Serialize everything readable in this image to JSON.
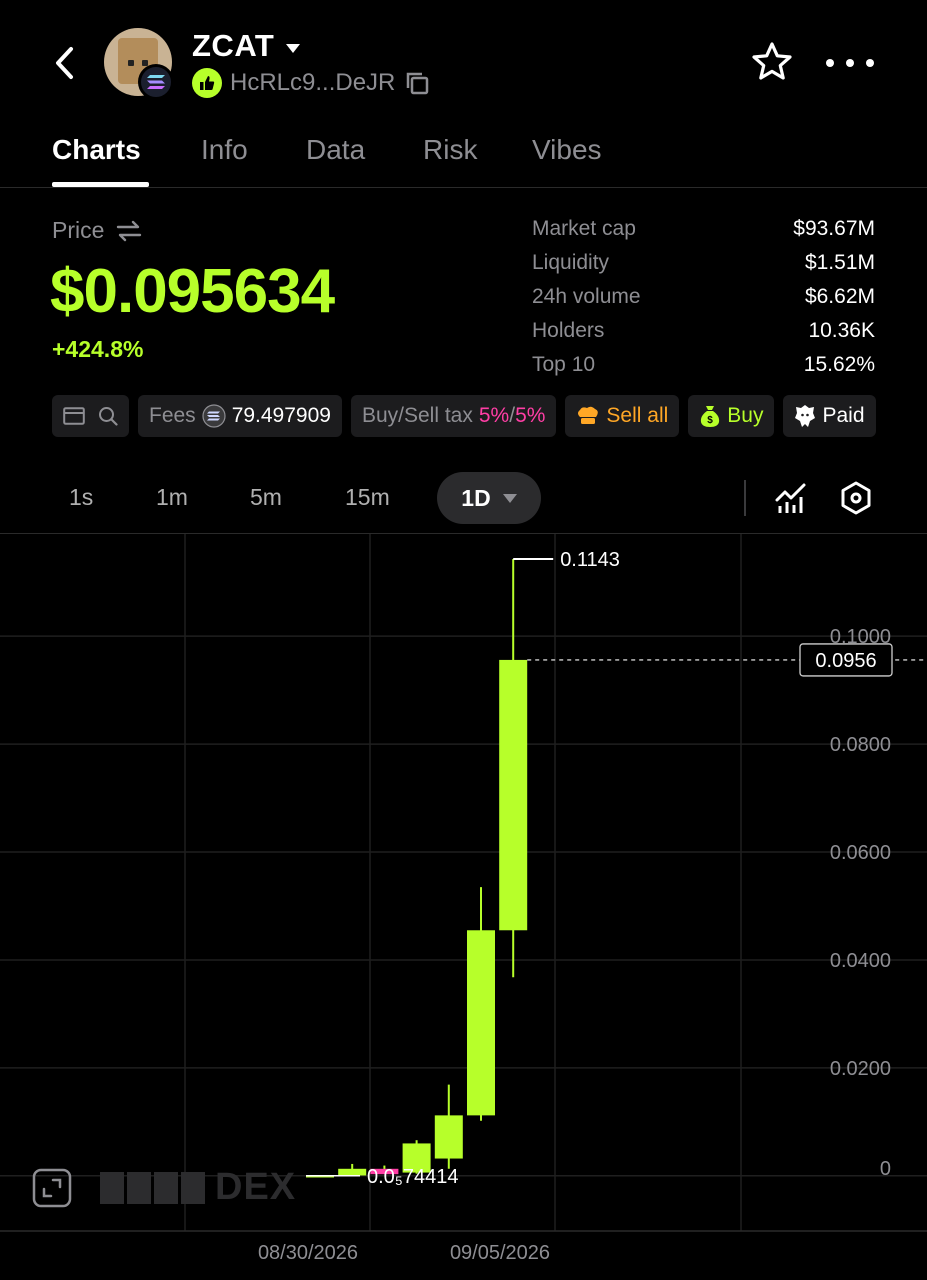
{
  "header": {
    "token_name": "ZCAT",
    "address": "HcRLc9...DeJR"
  },
  "tabs": [
    {
      "label": "Charts",
      "active": true
    },
    {
      "label": "Info"
    },
    {
      "label": "Data"
    },
    {
      "label": "Risk"
    },
    {
      "label": "Vibes"
    }
  ],
  "price": {
    "label": "Price",
    "value": "$0.095634",
    "change": "+424.8%"
  },
  "stats": [
    {
      "label": "Market cap",
      "value": "$93.67M"
    },
    {
      "label": "Liquidity",
      "value": "$1.51M"
    },
    {
      "label": "24h volume",
      "value": "$6.62M"
    },
    {
      "label": "Holders",
      "value": "10.36K"
    },
    {
      "label": "Top 10",
      "value": "15.62%"
    }
  ],
  "chips": {
    "fees_label": "Fees",
    "fees_value": "79.497909",
    "tax_label": "Buy/Sell tax",
    "tax_buy": "5%",
    "tax_sep": "/",
    "tax_sell": "5%",
    "sell_all": "Sell all",
    "buy": "Buy",
    "paid": "Paid"
  },
  "intervals": [
    "1s",
    "1m",
    "5m",
    "15m"
  ],
  "active_interval": "1D",
  "watermark": "DEX",
  "colors": {
    "accent": "#b7ff2a",
    "pink": "#ff3ea5",
    "orange": "#ffa726",
    "muted": "#8e8e93"
  },
  "chart_data": {
    "type": "candlestick",
    "y_ticks": [
      "0.1000",
      "0.0800",
      "0.0600",
      "0.0400",
      "0.0200",
      "0"
    ],
    "x_ticks": [
      "08/30/2026",
      "09/05/2026"
    ],
    "ylim": [
      -0.003,
      0.1143
    ],
    "high_label": "0.1143",
    "low_label": "0.0₅74414",
    "current_price_label": "0.0956",
    "candles": [
      {
        "open": 7.4e-06,
        "high": 1e-05,
        "low": 7.4e-06,
        "close": 6e-05
      },
      {
        "open": 6e-05,
        "high": 0.0022,
        "low": 3e-05,
        "close": 0.0013
      },
      {
        "open": 0.0013,
        "high": 0.0019,
        "low": 0.0009,
        "close": 0.0003
      },
      {
        "open": 0.0006,
        "high": 0.0066,
        "low": 0.0004,
        "close": 0.006
      },
      {
        "open": 0.0032,
        "high": 0.0169,
        "low": 0.0013,
        "close": 0.0112
      },
      {
        "open": 0.0112,
        "high": 0.0535,
        "low": 0.0102,
        "close": 0.0455
      },
      {
        "open": 0.0455,
        "high": 0.1143,
        "low": 0.0368,
        "close": 0.0956
      }
    ]
  }
}
